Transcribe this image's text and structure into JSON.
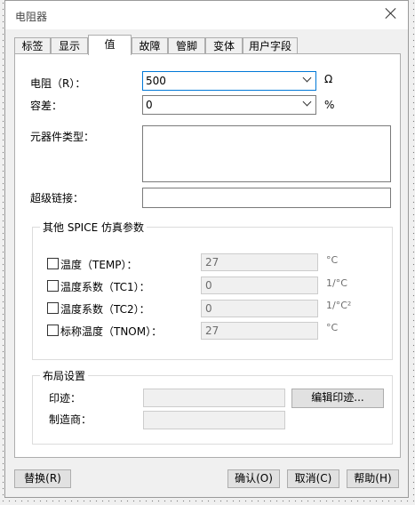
{
  "window": {
    "title": "电阻器",
    "close_icon": "close-icon"
  },
  "tabs": [
    {
      "label": "标签"
    },
    {
      "label": "显示"
    },
    {
      "label": "值"
    },
    {
      "label": "故障"
    },
    {
      "label": "管脚"
    },
    {
      "label": "变体"
    },
    {
      "label": "用户字段"
    }
  ],
  "active_tab": "值",
  "value_tab": {
    "resistance": {
      "label": "电阻（R）：",
      "value": "500",
      "unit": "Ω"
    },
    "tolerance": {
      "label": "容差：",
      "value": "0",
      "unit": "%"
    },
    "component_type": {
      "label": "元器件类型：",
      "value": ""
    },
    "hyperlink": {
      "label": "超级链接：",
      "value": ""
    },
    "spice": {
      "title": "其他 SPICE 仿真参数",
      "params": [
        {
          "label": "温度（TEMP）：",
          "value": "27",
          "unit": "°C",
          "checked": false
        },
        {
          "label": "温度系数（TC1）：",
          "value": "0",
          "unit": "1/°C",
          "checked": false
        },
        {
          "label": "温度系数（TC2）：",
          "value": "0",
          "unit": "1/°C²",
          "checked": false
        },
        {
          "label": "标称温度（TNOM）：",
          "value": "27",
          "unit": "°C",
          "checked": false
        }
      ]
    },
    "layout": {
      "title": "布局设置",
      "footprint_label": "印迹：",
      "footprint_value": "",
      "edit_footprint_button": "编辑印迹...",
      "manufacturer_label": "制造商：",
      "manufacturer_value": ""
    }
  },
  "buttons": {
    "replace": "替换(R)",
    "ok": "确认(O)",
    "cancel": "取消(C)",
    "help": "帮助(H)"
  }
}
